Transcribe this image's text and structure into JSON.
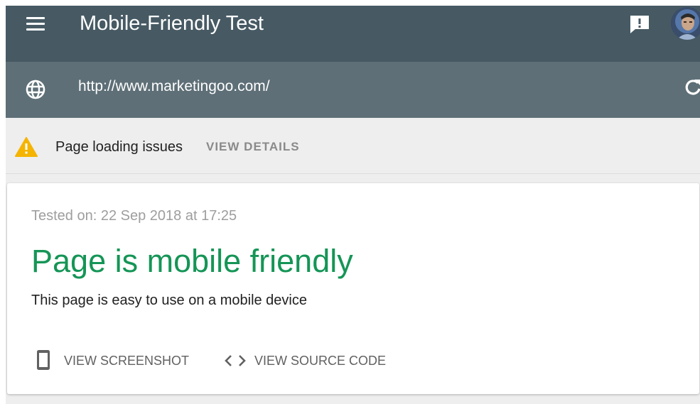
{
  "header": {
    "title": "Mobile-Friendly Test",
    "menu_icon": "hamburger-menu-icon",
    "feedback_icon": "feedback-icon",
    "avatar_icon": "user-avatar"
  },
  "urlbar": {
    "url": "http://www.marketingoo.com/",
    "globe_icon": "globe-icon",
    "reload_icon": "reload-icon"
  },
  "issues": {
    "text": "Page loading issues",
    "action": "VIEW DETAILS",
    "icon": "warning-icon",
    "icon_color": "#f5b400"
  },
  "result": {
    "tested_on": "Tested on: 22 Sep 2018 at 17:25",
    "title": "Page is mobile friendly",
    "description": "This page is easy to use on a mobile device",
    "title_color": "#159556",
    "actions": [
      {
        "label": "VIEW SCREENSHOT",
        "icon": "phone-icon"
      },
      {
        "label": "VIEW SOURCE CODE",
        "icon": "code-icon"
      }
    ]
  },
  "colors": {
    "header_bg": "#475a64",
    "urlbar_bg": "#5e6f77"
  }
}
